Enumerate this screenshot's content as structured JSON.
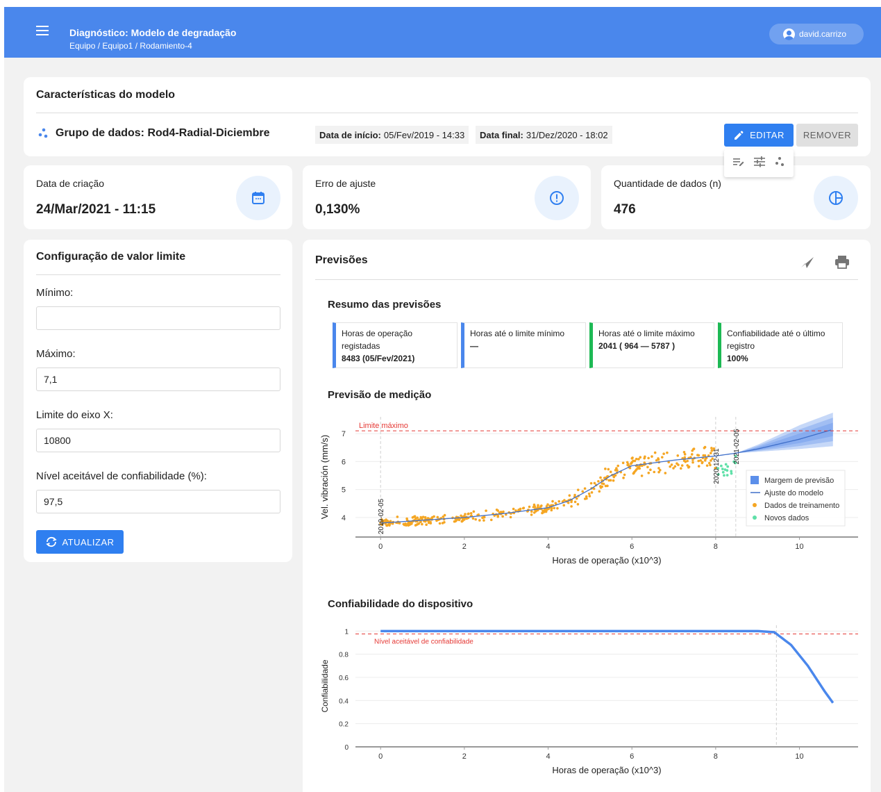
{
  "topbar": {
    "title": "Diagnóstico: Modelo de degradação",
    "breadcrumb": "Equipo / Equipo1 / Rodamiento-4",
    "user": "david.carrizo"
  },
  "characteristics": {
    "title": "Características do modelo",
    "dataset": "Grupo de dados: Rod4-Radial-Diciembre",
    "start_label": "Data de início:",
    "start_value": "05/Fev/2019 - 14:33",
    "end_label": "Data final:",
    "end_value": "31/Dez/2020 - 18:02",
    "edit_label": "EDITAR",
    "remove_label": "REMOVER"
  },
  "stats": [
    {
      "label": "Data de criação",
      "value": "24/Mar/2021 - 11:15",
      "icon": "calendar-icon"
    },
    {
      "label": "Erro de ajuste",
      "value": "0,130%",
      "icon": "alert-circle-icon"
    },
    {
      "label": "Quantidade de dados (n)",
      "value": "476",
      "icon": "pie-chart-icon"
    }
  ],
  "config": {
    "title": "Configuração de valor limite",
    "min_label": "Mínimo:",
    "min_value": "",
    "max_label": "Máximo:",
    "max_value": "7,1",
    "xlim_label": "Limite do eixo X:",
    "xlim_value": "10800",
    "conf_label": "Nível aceitável de confiabilidade (%):",
    "conf_value": "97,5",
    "update_label": "ATUALIZAR"
  },
  "previsoes": {
    "title": "Previsões",
    "summary_title": "Resumo das previsões",
    "summary": [
      {
        "label": "Horas de operação registadas",
        "value": "8483 (05/Fev/2021)",
        "color": "#4a87ec"
      },
      {
        "label": "Horas até o limite mínimo",
        "value": "—",
        "color": "#4a87ec"
      },
      {
        "label": "Horas até o limite máximo",
        "value": "2041 ( 964 — 5787 )",
        "color": "#1db954"
      },
      {
        "label": "Confiabilidade até o último registro",
        "value": "100%",
        "color": "#1db954"
      }
    ],
    "measure_title": "Previsão de medição",
    "reliability_title": "Confiabilidade do dispositivo"
  },
  "chart_data": [
    {
      "type": "scatter",
      "title": "Previsão de medição",
      "xlabel": "Horas de operação (x10^3)",
      "ylabel": "Vel. vibración (mm/s)",
      "xlim": [
        -0.6,
        11.4
      ],
      "ylim": [
        3.3,
        7.6
      ],
      "xticks": [
        0,
        2,
        4,
        6,
        8,
        10
      ],
      "yticks": [
        4,
        5,
        6,
        7
      ],
      "grid": true,
      "legend_position": "bottom-right",
      "threshold": {
        "label": "Limite máximo",
        "value": 7.1,
        "color": "#e53935"
      },
      "vlines": [
        {
          "x": 0,
          "label": "2019-02-05"
        },
        {
          "x": 8.0,
          "label": "2020-12-31"
        },
        {
          "x": 8.48,
          "label": "2021-02-05"
        }
      ],
      "legend": [
        "Margem de previsão",
        "Ajuste do modelo",
        "Dados de treinamento",
        "Novos dados"
      ],
      "series": [
        {
          "name": "Ajuste do modelo",
          "color": "#3f6fc9",
          "x": [
            0,
            1,
            2,
            3,
            4,
            4.5,
            5,
            5.5,
            6,
            7,
            8,
            8.48,
            9,
            10,
            10.8
          ],
          "y": [
            3.8,
            3.9,
            4.0,
            4.15,
            4.35,
            4.6,
            5.0,
            5.5,
            5.85,
            6.05,
            6.2,
            6.3,
            6.45,
            6.8,
            7.15
          ]
        },
        {
          "name": "Margem de previsão",
          "color": "#5b8fea",
          "x": [
            8.48,
            9,
            10,
            10.8
          ],
          "lower": [
            6.3,
            6.35,
            6.45,
            6.55
          ],
          "upper": [
            6.3,
            6.6,
            7.3,
            7.75
          ]
        },
        {
          "name": "Dados de treinamento",
          "color": "#f5a623",
          "x_range": [
            0,
            8.0
          ],
          "n": 476
        },
        {
          "name": "Novos dados",
          "color": "#5fe0a8",
          "x_range": [
            8.0,
            8.48
          ]
        }
      ]
    },
    {
      "type": "line",
      "title": "Confiabilidade do dispositivo",
      "xlabel": "Horas de operação (x10^3)",
      "ylabel": "Confiabilidade",
      "xlim": [
        -0.6,
        11.4
      ],
      "ylim": [
        0,
        1.05
      ],
      "xticks": [
        0,
        2,
        4,
        6,
        8,
        10
      ],
      "yticks": [
        0,
        0.2,
        0.4,
        0.6,
        0.8,
        1
      ],
      "threshold": {
        "label": "Nível aceitável de confiabilidade",
        "value": 0.975,
        "color": "#e53935"
      },
      "vline": {
        "x": 9.45
      },
      "series": [
        {
          "name": "Confiabilidade",
          "color": "#4a87ec",
          "x": [
            0,
            2,
            4,
            6,
            8,
            9.0,
            9.4,
            9.8,
            10.2,
            10.6,
            10.8
          ],
          "y": [
            1,
            1,
            1,
            1,
            1,
            1,
            0.99,
            0.88,
            0.7,
            0.48,
            0.38
          ]
        }
      ]
    }
  ]
}
